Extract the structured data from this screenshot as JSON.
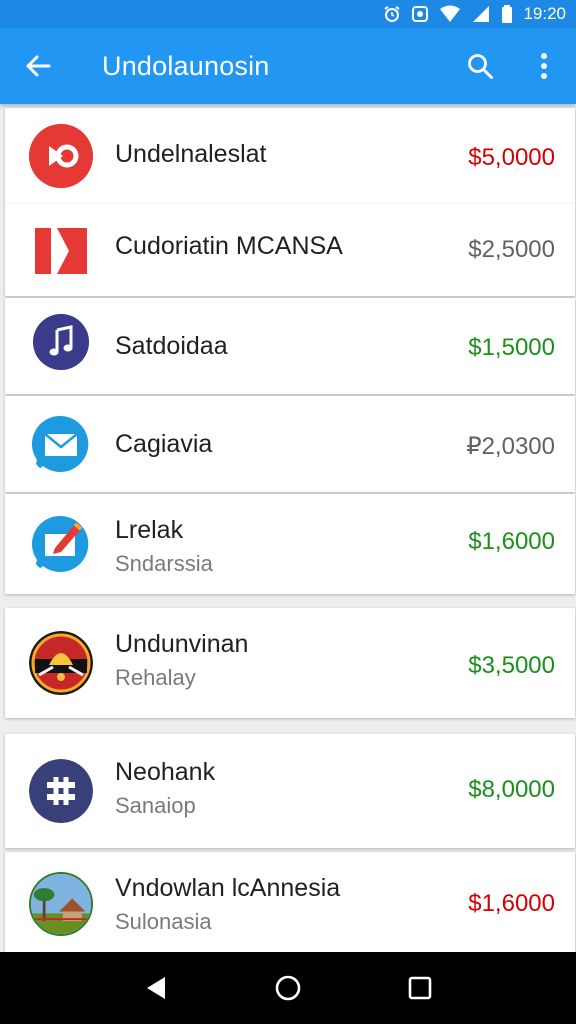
{
  "status_bar": {
    "time": "19:20",
    "icons": [
      "alarm-icon",
      "sync-icon",
      "wifi-icon",
      "signal-icon",
      "battery-icon"
    ]
  },
  "app_bar": {
    "title": "Undolaunosin",
    "back_icon": "arrow-left-icon",
    "search_icon": "search-icon",
    "menu_icon": "more-vert-icon",
    "color": "#2196f3"
  },
  "items": [
    {
      "name": "Undelnaleslat",
      "subtitle": "",
      "amount": "$5,0000",
      "amount_color": "#d50000",
      "icon": "red-circle-logo-icon"
    },
    {
      "name": "Cudoriatin MCANSA",
      "subtitle": "",
      "amount": "$2,5000",
      "amount_color": "#616161",
      "icon": "red-flag-logo-icon"
    },
    {
      "name": "Satdoidaa",
      "subtitle": "",
      "amount": "$1,5000",
      "amount_color": "#1b8e1b",
      "icon": "music-note-icon"
    },
    {
      "name": "Cagiavia",
      "subtitle": "",
      "amount": "₽2,0300",
      "amount_color": "#616161",
      "icon": "mail-icon"
    },
    {
      "name": "Lrelak",
      "subtitle": "Sndarssia",
      "amount": "$1,6000",
      "amount_color": "#1b8e1b",
      "icon": "edit-message-icon"
    },
    {
      "name": "Undunvinan",
      "subtitle": "Rehalay",
      "amount": "$3,5000",
      "amount_color": "#1b8e1b",
      "icon": "emblem-icon"
    },
    {
      "name": "Neohank",
      "subtitle": "Sanaiop",
      "amount": "$8,0000",
      "amount_color": "#1b8e1b",
      "icon": "bank-logo-icon"
    },
    {
      "name": "Vndowlan lcAnnesia",
      "subtitle": "Sulonasia",
      "amount": "$1,6000",
      "amount_color": "#d50000",
      "icon": "landmark-photo-icon"
    }
  ],
  "nav_bar": {
    "back_icon": "triangle-back-icon",
    "home_icon": "circle-home-icon",
    "recents_icon": "square-recents-icon"
  }
}
